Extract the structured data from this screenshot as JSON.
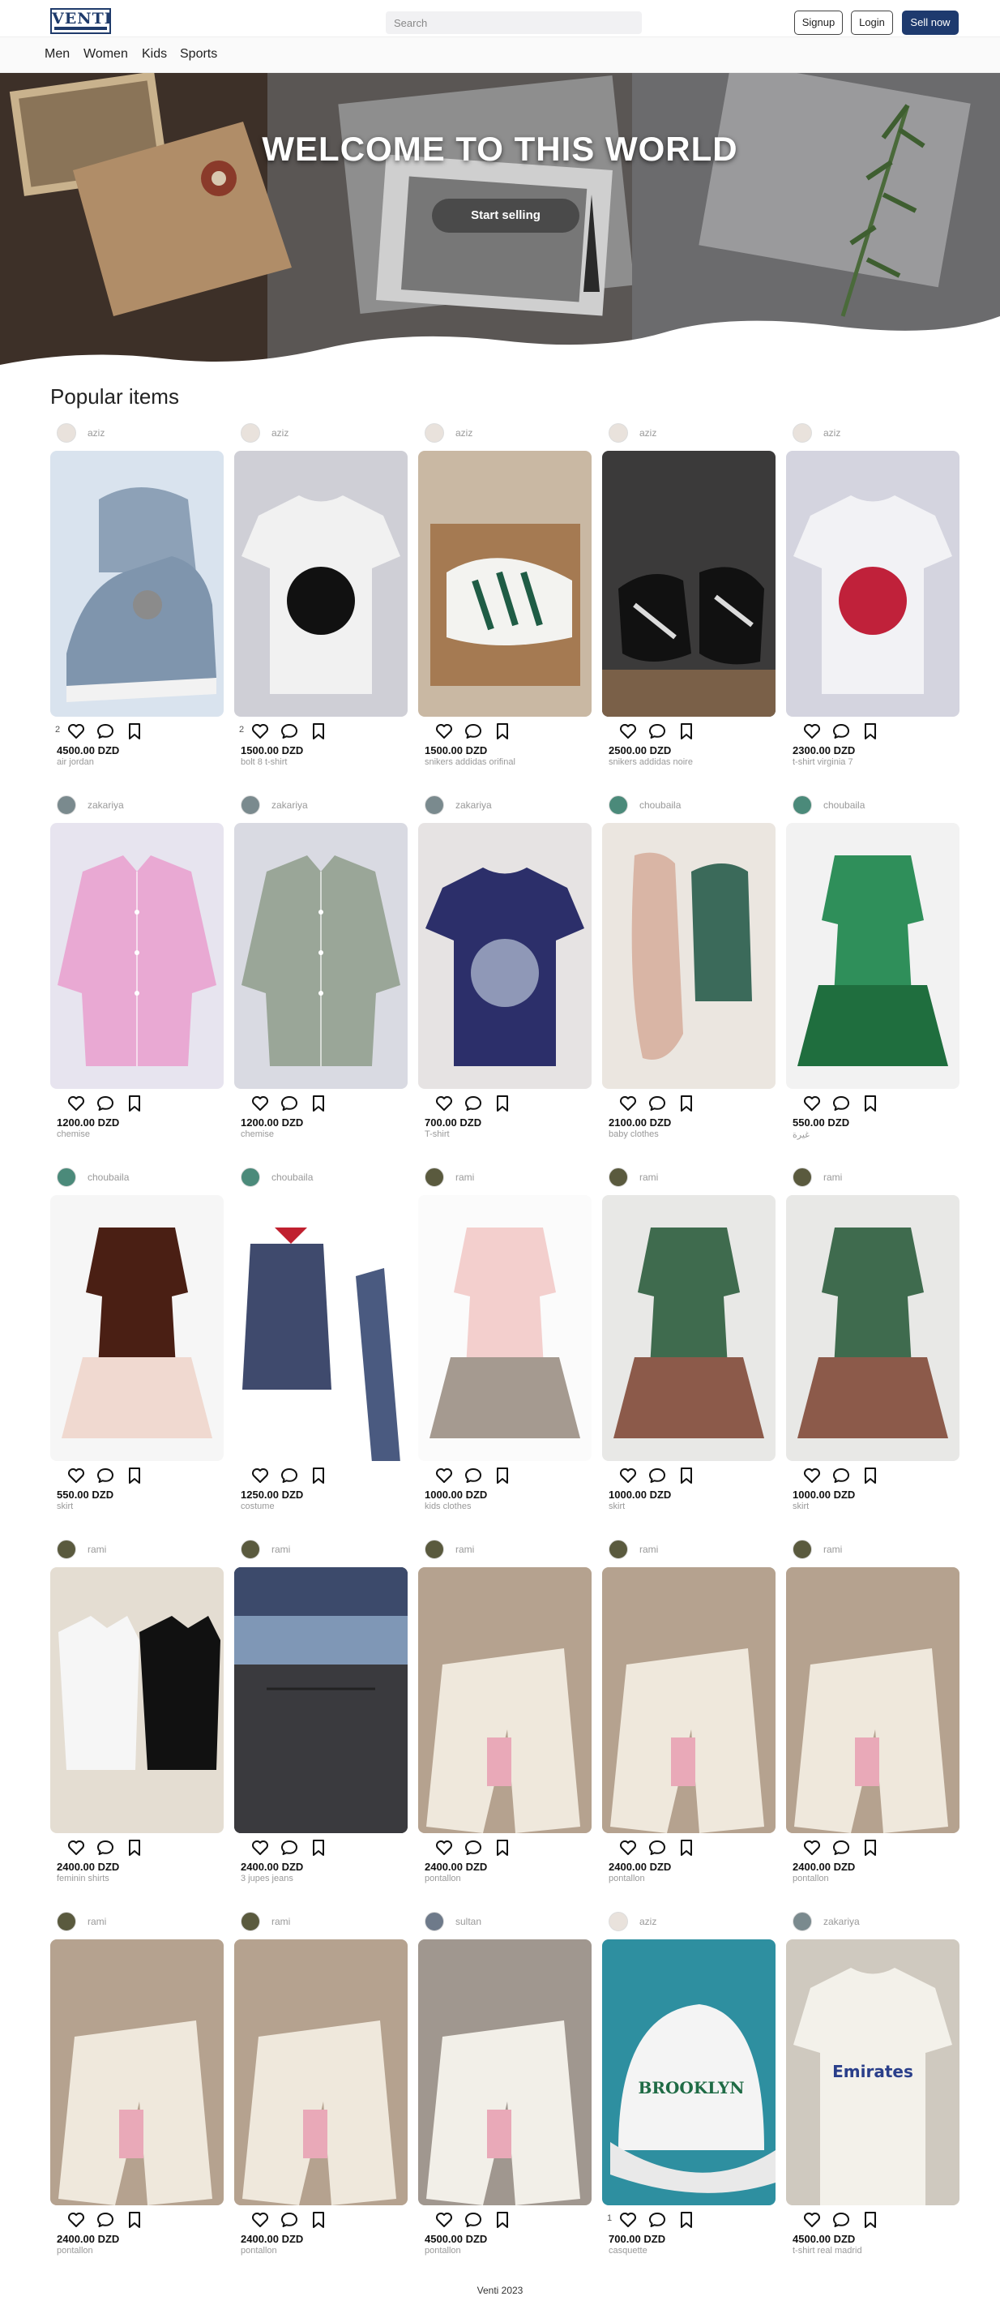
{
  "header": {
    "logo_text": "VENTI",
    "search_placeholder": "Search",
    "signup_label": "Signup",
    "login_label": "Login",
    "sell_label": "Sell now"
  },
  "categories": [
    "Men",
    "Women",
    "Kids",
    "Sports"
  ],
  "hero": {
    "title": "WELCOME TO THIS WORLD",
    "button_label": "Start selling"
  },
  "section_title": "Popular items",
  "products": [
    {
      "seller": "aziz",
      "likes": "2",
      "price": "4500.00 DZD",
      "title": "air jordan",
      "img_bg": "#d9e3ee",
      "art": "sneaker",
      "c1": "#7f95ad",
      "c2": "#f2f2f2",
      "avatar": "#e9e2dc"
    },
    {
      "seller": "aziz",
      "likes": "2",
      "price": "1500.00 DZD",
      "title": "bolt 8 t-shirt",
      "img_bg": "#cfcfd6",
      "art": "tee",
      "c1": "#f1f1f1",
      "c2": "#111111",
      "avatar": "#e9e2dc"
    },
    {
      "seller": "aziz",
      "likes": "",
      "price": "1500.00 DZD",
      "title": "snikers addidas orifinal",
      "img_bg": "#c9b8a3",
      "art": "box",
      "c1": "#a57a52",
      "c2": "#f3f3f0",
      "avatar": "#e9e2dc"
    },
    {
      "seller": "aziz",
      "likes": "",
      "price": "2500.00 DZD",
      "title": "snikers addidas noire",
      "img_bg": "#3b3a3a",
      "art": "shoes",
      "c1": "#111111",
      "c2": "#7a6048",
      "avatar": "#e9e2dc"
    },
    {
      "seller": "aziz",
      "likes": "",
      "price": "2300.00 DZD",
      "title": "t-shirt virginia 7",
      "img_bg": "#d4d4df",
      "art": "tee",
      "c1": "#f2f2f5",
      "c2": "#c0213a",
      "avatar": "#e9e2dc"
    },
    {
      "seller": "zakariya",
      "likes": "",
      "price": "1200.00 DZD",
      "title": "chemise",
      "img_bg": "#e7e4ef",
      "art": "shirt",
      "c1": "#e9a9d3",
      "c2": "#e9a9d3",
      "avatar": "#7a8a8e"
    },
    {
      "seller": "zakariya",
      "likes": "",
      "price": "1200.00 DZD",
      "title": "chemise",
      "img_bg": "#d9dae2",
      "art": "shirt",
      "c1": "#9aa698",
      "c2": "#9aa698",
      "avatar": "#7a8a8e"
    },
    {
      "seller": "zakariya",
      "likes": "",
      "price": "700.00 DZD",
      "title": "T-shirt",
      "img_bg": "#e6e3e3",
      "art": "tee",
      "c1": "#2c2f6a",
      "c2": "#8f98b7",
      "avatar": "#7a8a8e"
    },
    {
      "seller": "choubaila",
      "likes": "",
      "price": "2100.00 DZD",
      "title": "baby clothes",
      "img_bg": "#ebe6e0",
      "art": "romper",
      "c1": "#d9b5a5",
      "c2": "#3b6a5a",
      "avatar": "#4b8a7a"
    },
    {
      "seller": "choubaila",
      "likes": "",
      "price": "550.00 DZD",
      "title": "غيرة",
      "img_bg": "#f2f2f2",
      "art": "dress",
      "c1": "#2f8f5a",
      "c2": "#1f6e3e",
      "avatar": "#4b8a7a"
    },
    {
      "seller": "choubaila",
      "likes": "",
      "price": "550.00 DZD",
      "title": "skirt",
      "img_bg": "#f6f6f6",
      "art": "dress",
      "c1": "#4a1f14",
      "c2": "#f0d9d0",
      "avatar": "#4b8a7a"
    },
    {
      "seller": "choubaila",
      "likes": "",
      "price": "1250.00 DZD",
      "title": "costume",
      "img_bg": "#ffffff",
      "art": "suit",
      "c1": "#3f4a6d",
      "c2": "#c0202f",
      "avatar": "#4b8a7a"
    },
    {
      "seller": "rami",
      "likes": "",
      "price": "1000.00 DZD",
      "title": "kids clothes",
      "img_bg": "#fbfbfb",
      "art": "dress",
      "c1": "#f3cfcd",
      "c2": "#a59a90",
      "avatar": "#5a5a3e"
    },
    {
      "seller": "rami",
      "likes": "",
      "price": "1000.00 DZD",
      "title": "skirt",
      "img_bg": "#e8e8e6",
      "art": "dress",
      "c1": "#3f6b4e",
      "c2": "#8c5a4a",
      "avatar": "#5a5a3e"
    },
    {
      "seller": "rami",
      "likes": "",
      "price": "1000.00 DZD",
      "title": "skirt",
      "img_bg": "#e8e8e6",
      "art": "dress",
      "c1": "#3f6b4e",
      "c2": "#8c5a4a",
      "avatar": "#5a5a3e"
    },
    {
      "seller": "rami",
      "likes": "",
      "price": "2400.00 DZD",
      "title": "feminin shirts",
      "img_bg": "#e4ddd2",
      "art": "twotee",
      "c1": "#f6f6f6",
      "c2": "#111111",
      "avatar": "#5a5a3e"
    },
    {
      "seller": "rami",
      "likes": "",
      "price": "2400.00 DZD",
      "title": "3 jupes jeans",
      "img_bg": "#2f2f33",
      "art": "denim",
      "c1": "#7f97b6",
      "c2": "#3a3a3e",
      "avatar": "#5a5a3e"
    },
    {
      "seller": "rami",
      "likes": "",
      "price": "2400.00 DZD",
      "title": "pontallon",
      "img_bg": "#cdbfae",
      "art": "pants",
      "c1": "#efe8dc",
      "c2": "#8a6e55",
      "avatar": "#5a5a3e"
    },
    {
      "seller": "rami",
      "likes": "",
      "price": "2400.00 DZD",
      "title": "pontallon",
      "img_bg": "#cdbfae",
      "art": "pants",
      "c1": "#efe8dc",
      "c2": "#8a6e55",
      "avatar": "#5a5a3e"
    },
    {
      "seller": "rami",
      "likes": "",
      "price": "2400.00 DZD",
      "title": "pontallon",
      "img_bg": "#cdbfae",
      "art": "pants",
      "c1": "#efe8dc",
      "c2": "#8a6e55",
      "avatar": "#5a5a3e"
    },
    {
      "seller": "rami",
      "likes": "",
      "price": "2400.00 DZD",
      "title": "pontallon",
      "img_bg": "#cdbfae",
      "art": "pants",
      "c1": "#efe8dc",
      "c2": "#8a6e55",
      "avatar": "#5a5a3e"
    },
    {
      "seller": "rami",
      "likes": "",
      "price": "2400.00 DZD",
      "title": "pontallon",
      "img_bg": "#cdbfae",
      "art": "pants",
      "c1": "#efe8dc",
      "c2": "#8a6e55",
      "avatar": "#5a5a3e"
    },
    {
      "seller": "sultan",
      "likes": "",
      "price": "4500.00 DZD",
      "title": "pontallon",
      "img_bg": "#d8d2c8",
      "art": "pants",
      "c1": "#f2efe8",
      "c2": "#3a2a26",
      "avatar": "#6e7a8a"
    },
    {
      "seller": "aziz",
      "likes": "1",
      "price": "700.00 DZD",
      "title": "casquette",
      "img_bg": "#2e8fa0",
      "art": "cap",
      "c1": "#f4f4f4",
      "c2": "#1f6b45",
      "avatar": "#e9e2dc"
    },
    {
      "seller": "zakariya",
      "likes": "",
      "price": "4500.00 DZD",
      "title": "t-shirt real madrid",
      "img_bg": "#cfc9bf",
      "art": "jersey",
      "c1": "#f3f1ea",
      "c2": "#2a3f8a",
      "avatar": "#7a8a8e"
    }
  ],
  "footer": "Venti 2023",
  "colors": {
    "primary": "#1e3a6e",
    "hero_button": "#4a4a4a",
    "muted_text": "#999999"
  }
}
